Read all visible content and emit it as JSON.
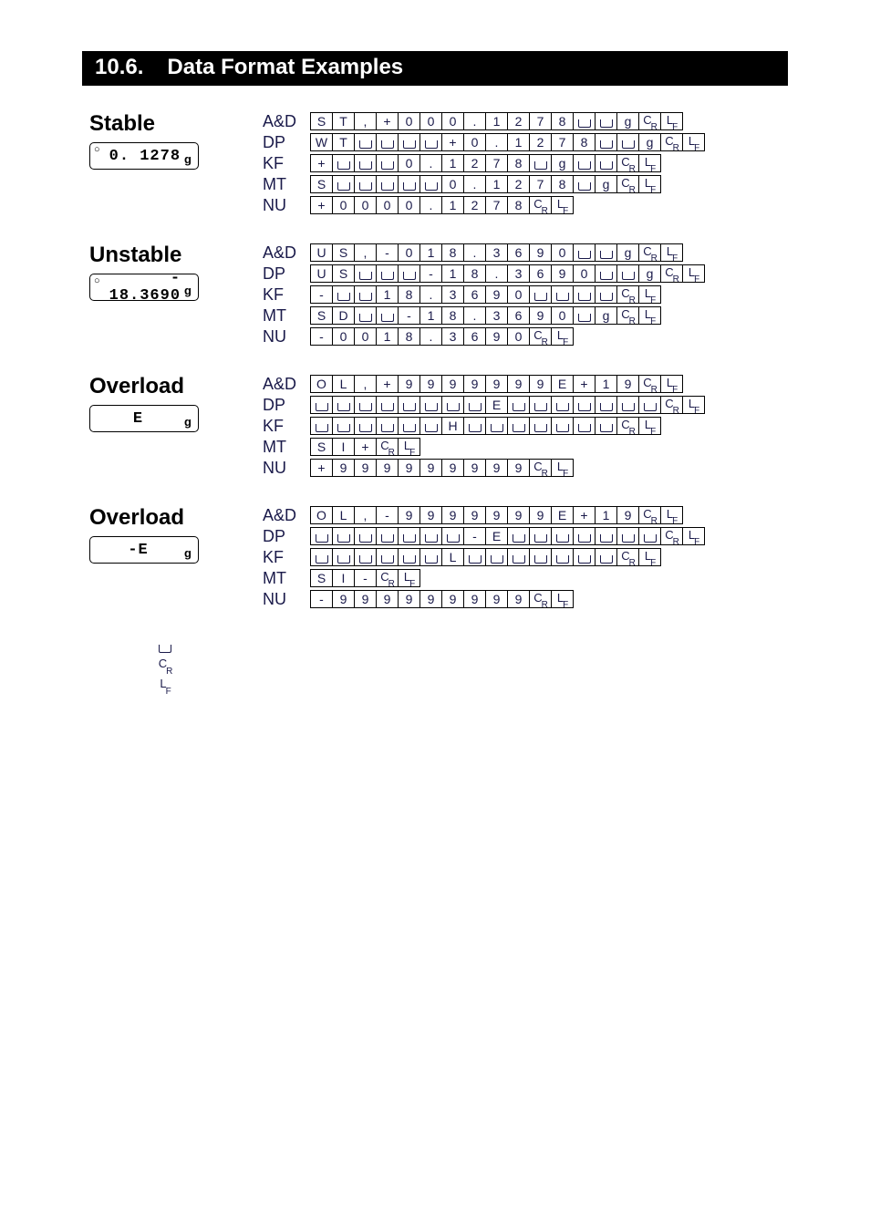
{
  "heading": {
    "num": "10.6.",
    "title": "Data Format Examples"
  },
  "glyphs": {
    "SP": "SP",
    "CR": "CR",
    "LF": "LF"
  },
  "sections": [
    {
      "title": "Stable",
      "display": {
        "circle": "○",
        "value": "0. 1278",
        "unit": "g"
      },
      "rows": [
        {
          "label": "A&D",
          "cells": [
            "S",
            "T",
            ",",
            "+",
            "0",
            "0",
            "0",
            ".",
            "1",
            "2",
            "7",
            "8",
            "SP",
            "SP",
            "g",
            "CR",
            "LF"
          ]
        },
        {
          "label": "DP",
          "cells": [
            "W",
            "T",
            "SP",
            "SP",
            "SP",
            "SP",
            "+",
            "0",
            ".",
            "1",
            "2",
            "7",
            "8",
            "SP",
            "SP",
            "g",
            "CR",
            "LF"
          ]
        },
        {
          "label": "KF",
          "cells": [
            "+",
            "SP",
            "SP",
            "SP",
            "0",
            ".",
            "1",
            "2",
            "7",
            "8",
            "SP",
            "g",
            "SP",
            "SP",
            "CR",
            "LF"
          ]
        },
        {
          "label": "MT",
          "cells": [
            "S",
            "SP",
            "SP",
            "SP",
            "SP",
            "SP",
            "0",
            ".",
            "1",
            "2",
            "7",
            "8",
            "SP",
            "g",
            "CR",
            "LF"
          ]
        },
        {
          "label": "NU",
          "cells": [
            "+",
            "0",
            "0",
            "0",
            "0",
            ".",
            "1",
            "2",
            "7",
            "8",
            "CR",
            "LF"
          ]
        }
      ]
    },
    {
      "title": "Unstable",
      "display": {
        "circle": "○",
        "value": "- 18.3690",
        "unit": "g"
      },
      "rows": [
        {
          "label": "A&D",
          "cells": [
            "U",
            "S",
            ",",
            "-",
            "0",
            "1",
            "8",
            ".",
            "3",
            "6",
            "9",
            "0",
            "SP",
            "SP",
            "g",
            "CR",
            "LF"
          ]
        },
        {
          "label": "DP",
          "cells": [
            "U",
            "S",
            "SP",
            "SP",
            "SP",
            "-",
            "1",
            "8",
            ".",
            "3",
            "6",
            "9",
            "0",
            "SP",
            "SP",
            "g",
            "CR",
            "LF"
          ]
        },
        {
          "label": "KF",
          "cells": [
            "-",
            "SP",
            "SP",
            "1",
            "8",
            ".",
            "3",
            "6",
            "9",
            "0",
            "SP",
            "SP",
            "SP",
            "SP",
            "CR",
            "LF"
          ]
        },
        {
          "label": "MT",
          "cells": [
            "S",
            "D",
            "SP",
            "SP",
            "-",
            "1",
            "8",
            ".",
            "3",
            "6",
            "9",
            "0",
            "SP",
            "g",
            "CR",
            "LF"
          ]
        },
        {
          "label": "NU",
          "cells": [
            "-",
            "0",
            "0",
            "1",
            "8",
            ".",
            "3",
            "6",
            "9",
            "0",
            "CR",
            "LF"
          ]
        }
      ]
    },
    {
      "title": "Overload",
      "display": {
        "circle": "",
        "value": "E",
        "unit": "g"
      },
      "rows": [
        {
          "label": "A&D",
          "cells": [
            "O",
            "L",
            ",",
            "+",
            "9",
            "9",
            "9",
            "9",
            "9",
            "9",
            "9",
            "E",
            "+",
            "1",
            "9",
            "CR",
            "LF"
          ]
        },
        {
          "label": "DP",
          "cells": [
            "SP",
            "SP",
            "SP",
            "SP",
            "SP",
            "SP",
            "SP",
            "SP",
            "E",
            "SP",
            "SP",
            "SP",
            "SP",
            "SP",
            "SP",
            "SP",
            "CR",
            "LF"
          ]
        },
        {
          "label": "KF",
          "cells": [
            "SP",
            "SP",
            "SP",
            "SP",
            "SP",
            "SP",
            "H",
            "SP",
            "SP",
            "SP",
            "SP",
            "SP",
            "SP",
            "SP",
            "CR",
            "LF"
          ]
        },
        {
          "label": "MT",
          "cells": [
            "S",
            "I",
            "+",
            "CR",
            "LF"
          ]
        },
        {
          "label": "NU",
          "cells": [
            "+",
            "9",
            "9",
            "9",
            "9",
            "9",
            "9",
            "9",
            "9",
            "9",
            "CR",
            "LF"
          ]
        }
      ]
    },
    {
      "title": "Overload",
      "display": {
        "circle": "",
        "value": "-E",
        "unit": "g"
      },
      "rows": [
        {
          "label": "A&D",
          "cells": [
            "O",
            "L",
            ",",
            "-",
            "9",
            "9",
            "9",
            "9",
            "9",
            "9",
            "9",
            "E",
            "+",
            "1",
            "9",
            "CR",
            "LF"
          ]
        },
        {
          "label": "DP",
          "cells": [
            "SP",
            "SP",
            "SP",
            "SP",
            "SP",
            "SP",
            "SP",
            "-",
            "E",
            "SP",
            "SP",
            "SP",
            "SP",
            "SP",
            "SP",
            "SP",
            "CR",
            "LF"
          ]
        },
        {
          "label": "KF",
          "cells": [
            "SP",
            "SP",
            "SP",
            "SP",
            "SP",
            "SP",
            "L",
            "SP",
            "SP",
            "SP",
            "SP",
            "SP",
            "SP",
            "SP",
            "CR",
            "LF"
          ]
        },
        {
          "label": "MT",
          "cells": [
            "S",
            "I",
            "-",
            "CR",
            "LF"
          ]
        },
        {
          "label": "NU",
          "cells": [
            "-",
            "9",
            "9",
            "9",
            "9",
            "9",
            "9",
            "9",
            "9",
            "9",
            "CR",
            "LF"
          ]
        }
      ]
    }
  ],
  "legend": [
    {
      "glyph": "SP",
      "desc": ""
    },
    {
      "glyph": "CR",
      "desc": ""
    },
    {
      "glyph": "LF",
      "desc": ""
    }
  ]
}
